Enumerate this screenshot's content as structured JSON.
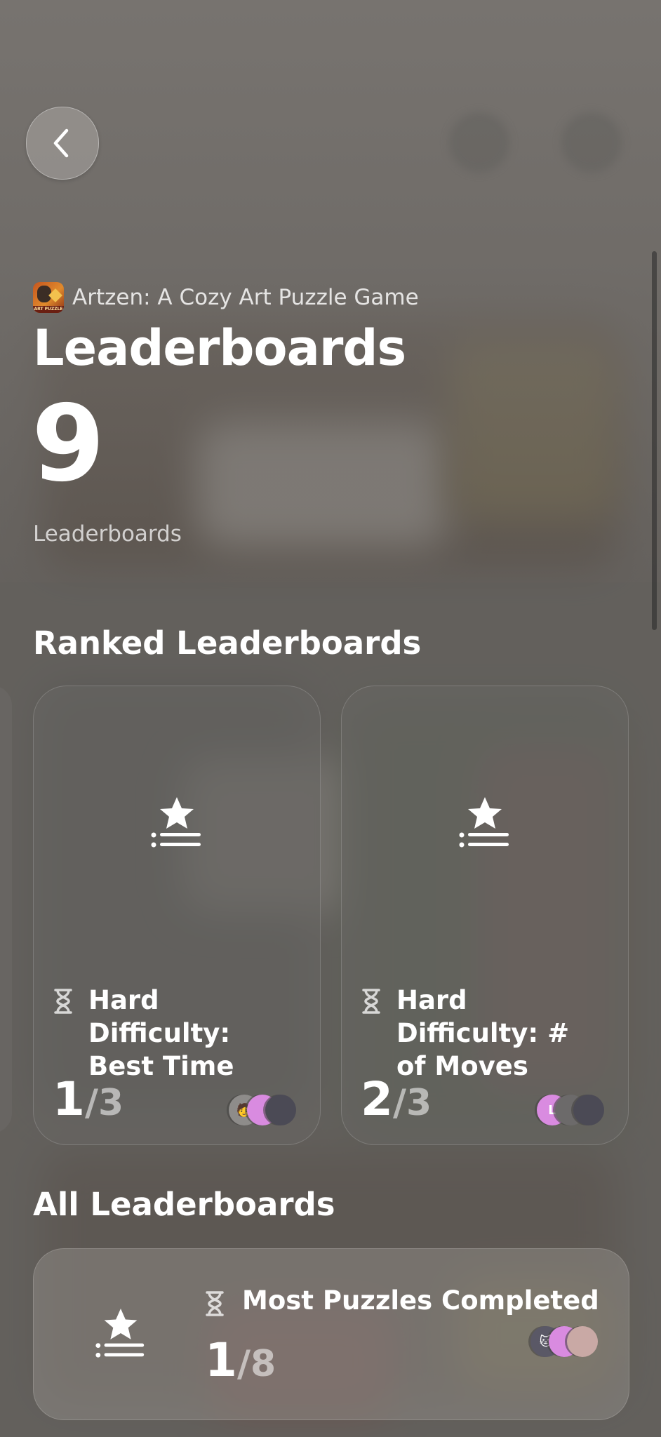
{
  "app": {
    "name": "Artzen: A Cozy Art Puzzle Game",
    "icon": "artzen-app-icon"
  },
  "header": {
    "title": "Leaderboards",
    "back_icon": "chevron-left-icon"
  },
  "summary": {
    "count": "9",
    "label": "Leaderboards"
  },
  "ranked": {
    "title": "Ranked Leaderboards",
    "cards": [
      {
        "title": "Hard Difficulty: Best Time",
        "rank": "1",
        "total": "3",
        "icon": "leaderboard-star-icon",
        "type_icon": "hourglass-icon",
        "avatars": [
          {
            "color": "#8e8c8a",
            "glyph": "🧑"
          },
          {
            "color": "#d98be0",
            "glyph": ""
          },
          {
            "color": "#4b4a55",
            "glyph": ""
          }
        ]
      },
      {
        "title": "Hard Difficulty: # of Moves",
        "rank": "2",
        "total": "3",
        "icon": "leaderboard-star-icon",
        "type_icon": "hourglass-icon",
        "avatars": [
          {
            "color": "#d98be0",
            "glyph": "L"
          },
          {
            "color": "#6c6a6a",
            "glyph": ""
          },
          {
            "color": "#4b4a55",
            "glyph": ""
          }
        ]
      }
    ]
  },
  "all": {
    "title": "All Leaderboards",
    "items": [
      {
        "title": "Most Puzzles Completed",
        "rank": "1",
        "total": "8",
        "icon": "leaderboard-star-icon",
        "type_icon": "hourglass-icon",
        "avatars": [
          {
            "color": "#5a5866",
            "glyph": "🐱"
          },
          {
            "color": "#d98be0",
            "glyph": ""
          },
          {
            "color": "#c9a9a5",
            "glyph": ""
          }
        ]
      }
    ]
  },
  "separator": "/"
}
